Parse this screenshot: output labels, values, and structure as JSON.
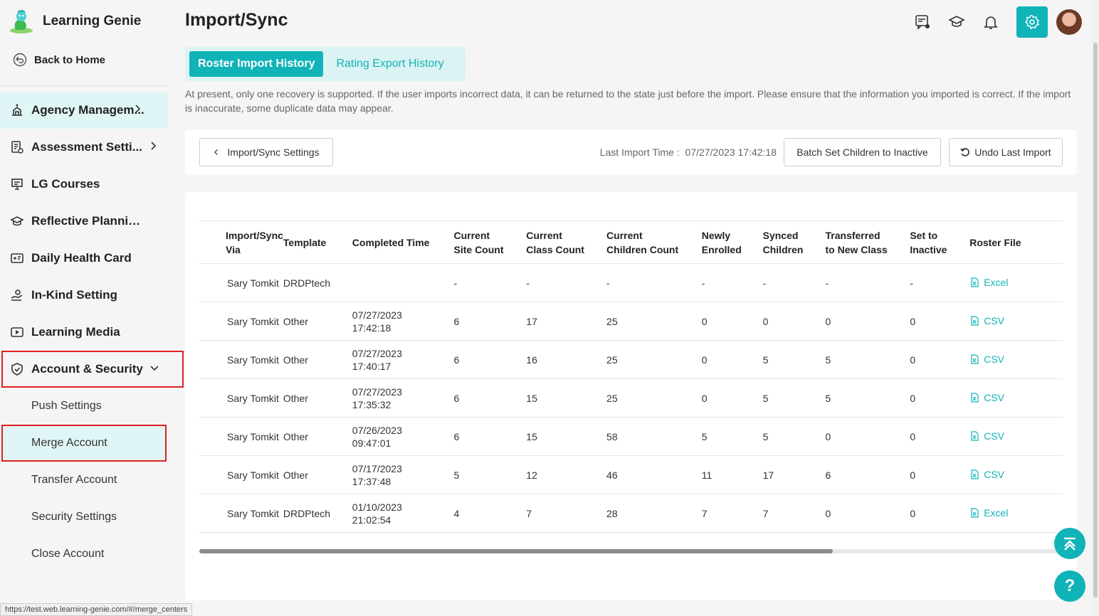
{
  "app": {
    "name": "Learning Genie"
  },
  "sidebar": {
    "back_label": "Back to Home",
    "items": [
      {
        "label": "Agency Managem...",
        "icon": "agency-icon",
        "has_chevron": true
      },
      {
        "label": "Assessment Setti...",
        "icon": "assessment-icon",
        "has_chevron": true
      },
      {
        "label": "LG Courses",
        "icon": "courses-icon"
      },
      {
        "label": "Reflective Planning S...",
        "icon": "planning-icon"
      },
      {
        "label": "Daily Health Card",
        "icon": "health-card-icon"
      },
      {
        "label": "In-Kind Setting",
        "icon": "in-kind-icon"
      },
      {
        "label": "Learning Media",
        "icon": "media-icon"
      },
      {
        "label": "Account & Security",
        "icon": "shield-icon",
        "expanded": true
      }
    ],
    "subitems": [
      {
        "label": "Push Settings"
      },
      {
        "label": "Merge Account",
        "selected": true
      },
      {
        "label": "Transfer Account"
      },
      {
        "label": "Security Settings"
      },
      {
        "label": "Close Account"
      }
    ]
  },
  "header": {
    "title": "Import/Sync"
  },
  "tabs": [
    {
      "label": "Roster Import History",
      "active": true
    },
    {
      "label": "Rating Export History",
      "active": false
    }
  ],
  "notice": "At present, only one recovery is supported. If the user imports incorrect data, it can be returned to the state just before the import. Please ensure that the information you imported is correct. If the import is inaccurate, some duplicate data may appear.",
  "toolbar": {
    "settings_label": "Import/Sync Settings",
    "last_import_label": "Last Import Time :",
    "last_import_value": "07/27/2023 17:42:18",
    "batch_label": "Batch Set Children to Inactive",
    "undo_label": "Undo Last Import"
  },
  "table": {
    "columns": [
      [
        "Import/Sync",
        "Via"
      ],
      [
        "Template"
      ],
      [
        "Completed Time"
      ],
      [
        "Current",
        "Site Count"
      ],
      [
        "Current",
        "Class Count"
      ],
      [
        "Current",
        "Children Count"
      ],
      [
        "Newly",
        "Enrolled"
      ],
      [
        "Synced",
        "Children"
      ],
      [
        "Transferred",
        "to New Class"
      ],
      [
        "Set to",
        "Inactive"
      ],
      [
        "Roster File"
      ]
    ],
    "rows": [
      {
        "via": "Sary Tomkit",
        "template": "DRDPtech",
        "date": "",
        "time": "",
        "site": "-",
        "class": "-",
        "children": "-",
        "enrolled": "-",
        "synced": "-",
        "transferred": "-",
        "inactive": "-",
        "file": "Excel"
      },
      {
        "via": "Sary Tomkit",
        "template": "Other",
        "date": "07/27/2023",
        "time": "17:42:18",
        "site": "6",
        "class": "17",
        "children": "25",
        "enrolled": "0",
        "synced": "0",
        "transferred": "0",
        "inactive": "0",
        "file": "CSV"
      },
      {
        "via": "Sary Tomkit",
        "template": "Other",
        "date": "07/27/2023",
        "time": "17:40:17",
        "site": "6",
        "class": "16",
        "children": "25",
        "enrolled": "0",
        "synced": "5",
        "transferred": "5",
        "inactive": "0",
        "file": "CSV"
      },
      {
        "via": "Sary Tomkit",
        "template": "Other",
        "date": "07/27/2023",
        "time": "17:35:32",
        "site": "6",
        "class": "15",
        "children": "25",
        "enrolled": "0",
        "synced": "5",
        "transferred": "5",
        "inactive": "0",
        "file": "CSV"
      },
      {
        "via": "Sary Tomkit",
        "template": "Other",
        "date": "07/26/2023",
        "time": "09:47:01",
        "site": "6",
        "class": "15",
        "children": "58",
        "enrolled": "5",
        "synced": "5",
        "transferred": "0",
        "inactive": "0",
        "file": "CSV"
      },
      {
        "via": "Sary Tomkit",
        "template": "Other",
        "date": "07/17/2023",
        "time": "17:37:48",
        "site": "5",
        "class": "12",
        "children": "46",
        "enrolled": "11",
        "synced": "17",
        "transferred": "6",
        "inactive": "0",
        "file": "CSV"
      },
      {
        "via": "Sary Tomkit",
        "template": "DRDPtech",
        "date": "01/10/2023",
        "time": "21:02:54",
        "site": "4",
        "class": "7",
        "children": "28",
        "enrolled": "7",
        "synced": "7",
        "transferred": "0",
        "inactive": "0",
        "file": "Excel"
      }
    ]
  },
  "status_url": "https://test.web.learning-genie.com/#/merge_centers",
  "help_glyph": "?",
  "colors": {
    "accent": "#10b3b7",
    "highlight_bg": "#e0f5f5",
    "outline_red": "#e02020"
  }
}
